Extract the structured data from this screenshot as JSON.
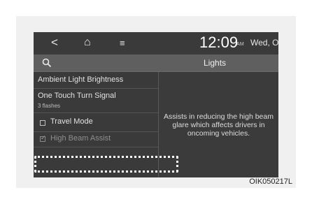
{
  "status_bar": {
    "back_icon": "<",
    "home_icon": "⌂",
    "menu_icon": "≡",
    "time": "12:09",
    "ampm": "AM",
    "date": "Wed, Oc"
  },
  "title_bar": {
    "title": "Lights"
  },
  "settings_list": [
    {
      "label": "Ambient Light Brightness"
    },
    {
      "label": "One Touch Turn Signal",
      "sub": "3 flashes"
    },
    {
      "label": "Travel Mode",
      "checked": false
    },
    {
      "label": "High Beam Assist",
      "checked": true,
      "highlighted": true
    }
  ],
  "description": "Assists in reducing the high beam glare which affects drivers in oncoming vehicles.",
  "figure_code": "OIK050217L",
  "colors": {
    "screen_bg": "#3b3b3b",
    "title_bar_bg": "#5f5f5f",
    "highlight": "#ffffff"
  }
}
